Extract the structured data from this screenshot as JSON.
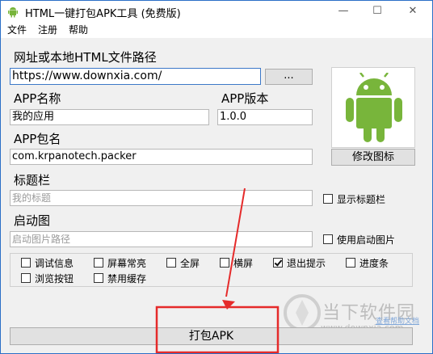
{
  "window": {
    "title": "HTML一键打包APK工具 (免费版)",
    "controls": {
      "minimize": "—",
      "maximize": "☐",
      "close": "✕"
    }
  },
  "menu": [
    {
      "label": "文件"
    },
    {
      "label": "注册"
    },
    {
      "label": "帮助"
    }
  ],
  "url": {
    "label": "网址或本地HTML文件路径",
    "value": "https://www.downxia.com/",
    "browse_label": "..."
  },
  "app_name": {
    "label": "APP名称",
    "value": "我的应用"
  },
  "app_version": {
    "label": "APP版本",
    "value": "1.0.0"
  },
  "package": {
    "label": "APP包名",
    "value": "com.krpanotech.packer"
  },
  "icon": {
    "button_label": "修改图标",
    "color": "#78b53b"
  },
  "title_bar": {
    "label": "标题栏",
    "placeholder": "我的标题",
    "checkbox_label": "显示标题栏",
    "checked": false
  },
  "splash": {
    "label": "启动图",
    "placeholder": "启动图片路径",
    "checkbox_label": "使用启动图片",
    "checked": false
  },
  "options": [
    {
      "label": "调试信息",
      "checked": false
    },
    {
      "label": "屏幕常亮",
      "checked": false
    },
    {
      "label": "全屏",
      "checked": false
    },
    {
      "label": "横屏",
      "checked": false
    },
    {
      "label": "退出提示",
      "checked": true
    },
    {
      "label": "进度条",
      "checked": false
    },
    {
      "label": "浏览按钮",
      "checked": false
    },
    {
      "label": "禁用缓存",
      "checked": false
    }
  ],
  "pack_button": {
    "label": "打包APK"
  },
  "watermark": {
    "brand": "当下软件园",
    "url": "www.downxia.com",
    "link": "查看帮助文档"
  },
  "annotation": {
    "color": "#e52a2a"
  }
}
